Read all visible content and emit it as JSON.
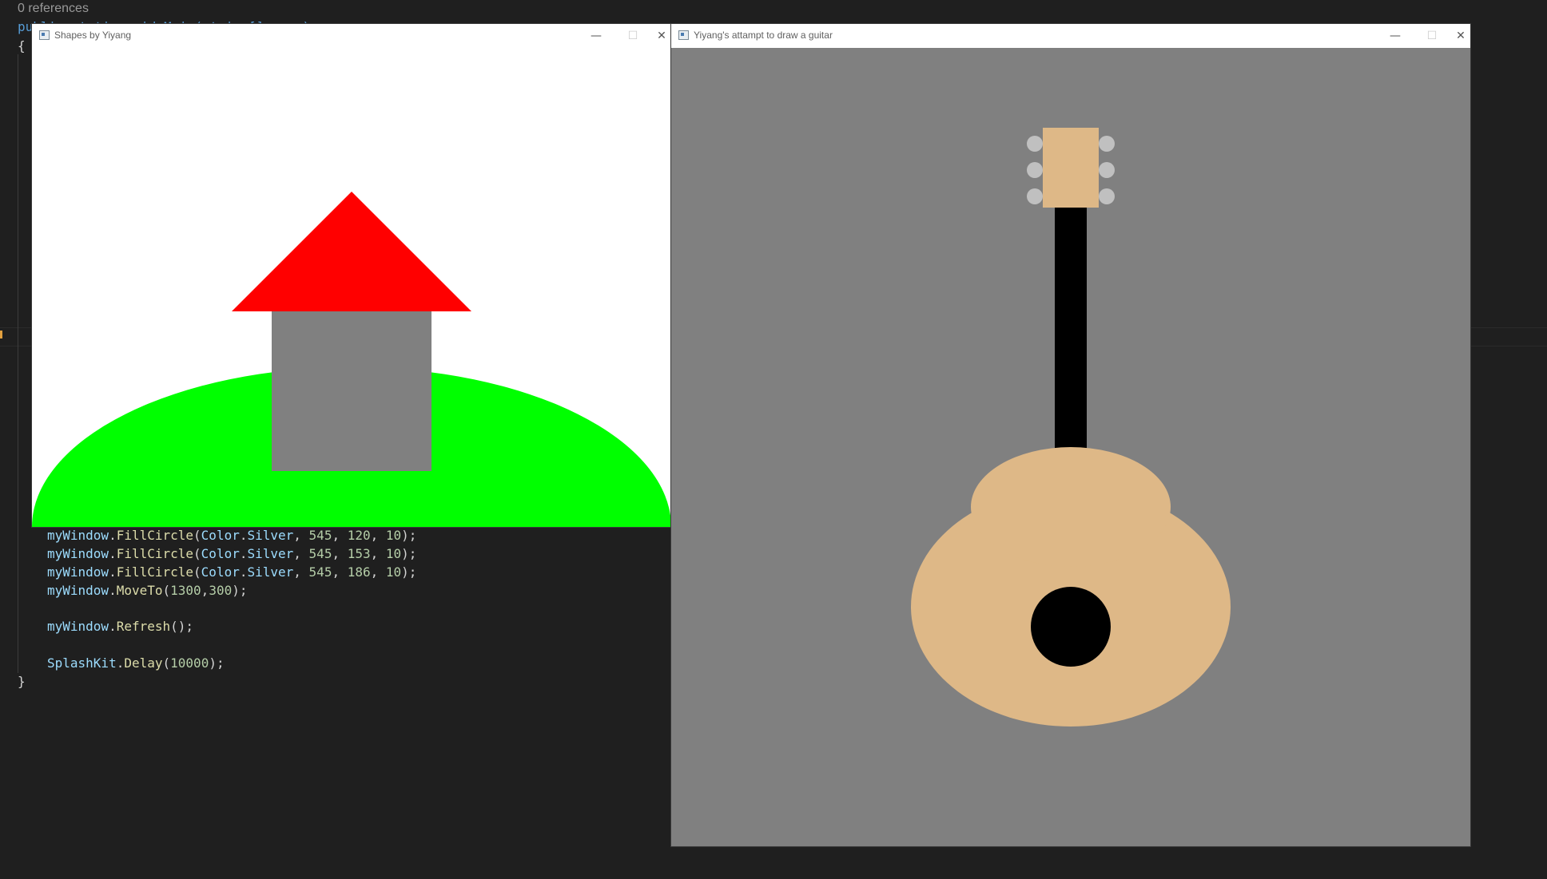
{
  "editor": {
    "codelens": "0 references",
    "header_line": "public static void Main(string[] args)",
    "open_brace": "{",
    "close_brace": "}",
    "lines": [
      {
        "obj": "myWindow",
        "dot": ".",
        "method": "FillCircle",
        "open": "(",
        "cls": "Color",
        "dot2": ".",
        "member": "Silver",
        "sep1": ", ",
        "a": "545",
        "sep2": ", ",
        "b": "120",
        "sep3": ", ",
        "c": "10",
        "close": ");"
      },
      {
        "obj": "myWindow",
        "dot": ".",
        "method": "FillCircle",
        "open": "(",
        "cls": "Color",
        "dot2": ".",
        "member": "Silver",
        "sep1": ", ",
        "a": "545",
        "sep2": ", ",
        "b": "153",
        "sep3": ", ",
        "c": "10",
        "close": ");"
      },
      {
        "obj": "myWindow",
        "dot": ".",
        "method": "FillCircle",
        "open": "(",
        "cls": "Color",
        "dot2": ".",
        "member": "Silver",
        "sep1": ", ",
        "a": "545",
        "sep2": ", ",
        "b": "186",
        "sep3": ", ",
        "c": "10",
        "close": ");"
      }
    ],
    "moveto": {
      "obj": "myWindow",
      "dot": ".",
      "method": "MoveTo",
      "open": "(",
      "a": "1300",
      "comma": ",",
      "b": "300",
      "close": ");"
    },
    "refresh": {
      "obj": "myWindow",
      "dot": ".",
      "method": "Refresh",
      "call": "();"
    },
    "delay": {
      "obj": "SplashKit",
      "dot": ".",
      "method": "Delay",
      "open": "(",
      "a": "10000",
      "close": ");"
    }
  },
  "shapes_window": {
    "title": "Shapes by Yiyang",
    "minimize": "—",
    "maximize": "☐",
    "close": "✕",
    "colors": {
      "sky": "#ffffff",
      "hill": "#00ff00",
      "house": "#808080",
      "roof": "#ff0000"
    }
  },
  "guitar_window": {
    "title": "Yiyang's attampt to draw a guitar",
    "minimize": "—",
    "maximize": "☐",
    "close": "✕",
    "colors": {
      "background": "#808080",
      "body": "#deb887",
      "neck": "#000000",
      "headstock": "#deb887",
      "pegs": "#c0c0c0",
      "sound_hole": "#000000"
    }
  }
}
